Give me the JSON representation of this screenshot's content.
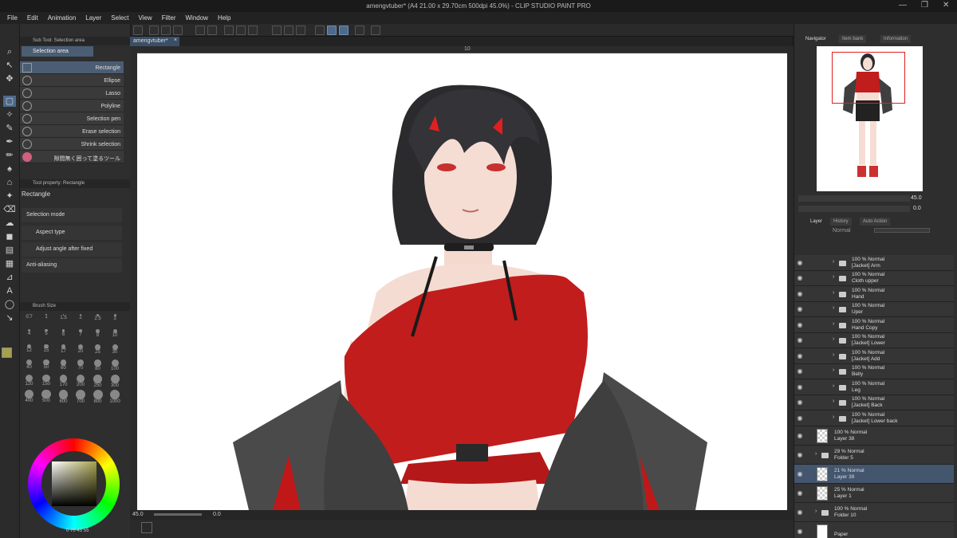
{
  "app": {
    "title": "amengvtuber* (A4 21.00 x 29.70cm 500dpi 45.0%) - CLIP STUDIO PAINT PRO"
  },
  "window_controls": {
    "minimize": "—",
    "restore": "❐",
    "close": "✕"
  },
  "menu": [
    "File",
    "Edit",
    "Animation",
    "Layer",
    "Select",
    "View",
    "Filter",
    "Window",
    "Help"
  ],
  "document_tab": {
    "label": "amengvtuber*",
    "close": "×"
  },
  "ruler": {
    "label": "10"
  },
  "subtool": {
    "panel_title": "Sub Tool: Selection area",
    "group_tab": "Selection area",
    "items": [
      {
        "label": "Rectangle",
        "selected": true
      },
      {
        "label": "Ellipse",
        "selected": false
      },
      {
        "label": "Lasso",
        "selected": false
      },
      {
        "label": "Polyline",
        "selected": false
      },
      {
        "label": "Selection pen",
        "selected": false
      },
      {
        "label": "Erase selection",
        "selected": false
      },
      {
        "label": "Shrink selection",
        "selected": false
      },
      {
        "label": "隙間無く囲って塗るツール",
        "selected": false
      }
    ]
  },
  "tool_property": {
    "panel_title": "Tool property: Rectangle",
    "name": "Rectangle",
    "selection_mode": "Selection mode",
    "aspect_type": "Aspect type",
    "adjust_angle": "Adjust angle after fixed",
    "anti_aliasing": "Anti-aliasing"
  },
  "brush_size": {
    "panel_title": "Brush Size",
    "rows": [
      [
        "0.7",
        "1",
        "1.5",
        "2",
        "2.5",
        "3"
      ],
      [
        "4",
        "5",
        "6",
        "7",
        "8",
        "10"
      ],
      [
        "12",
        "15",
        "17",
        "20",
        "25",
        "30"
      ],
      [
        "40",
        "50",
        "60",
        "70",
        "80",
        "100"
      ],
      [
        "120",
        "150",
        "170",
        "200",
        "250",
        "300"
      ],
      [
        "400",
        "500",
        "600",
        "700",
        "800",
        "1000"
      ]
    ]
  },
  "color": {
    "main": "#a6a24c",
    "sub": "#3a5a9a",
    "readout": [
      "0",
      "70",
      "45",
      "55"
    ]
  },
  "navigator": {
    "tabs": [
      "Navigator",
      "Item bank",
      "Information"
    ],
    "zoom": "45.0",
    "rotate": "0.0"
  },
  "layer_panel": {
    "tabs": [
      "Layer",
      "History",
      "Auto Action"
    ],
    "blend_mode": "Normal",
    "layers": [
      {
        "opacity": "100 % Normal",
        "name": "[Jacket] Arm",
        "type": "folder"
      },
      {
        "opacity": "100 % Normal",
        "name": "Cloth upper",
        "type": "folder"
      },
      {
        "opacity": "100 % Normal",
        "name": "Hand",
        "type": "folder"
      },
      {
        "opacity": "100 % Normal",
        "name": "Uper",
        "type": "folder"
      },
      {
        "opacity": "100 % Normal",
        "name": "Hand Copy",
        "type": "folder"
      },
      {
        "opacity": "100 % Normal",
        "name": "[Jacket] Lower",
        "type": "folder"
      },
      {
        "opacity": "100 % Normal",
        "name": "[Jacket] Add",
        "type": "folder"
      },
      {
        "opacity": "100 % Normal",
        "name": "Belly",
        "type": "folder"
      },
      {
        "opacity": "100 % Normal",
        "name": "Leg",
        "type": "folder"
      },
      {
        "opacity": "100 % Normal",
        "name": "[Jacket] Back",
        "type": "folder"
      },
      {
        "opacity": "100 % Normal",
        "name": "[Jacket] Lower back",
        "type": "folder"
      },
      {
        "opacity": "100 % Normal",
        "name": "Layer 38",
        "type": "raster"
      },
      {
        "opacity": "29 % Normal",
        "name": "Folder 5",
        "type": "folder"
      },
      {
        "opacity": "21 % Normal",
        "name": "Layer 39",
        "type": "raster"
      },
      {
        "opacity": "25 % Normal",
        "name": "Layer 1",
        "type": "vector"
      },
      {
        "opacity": "100 % Normal",
        "name": "Folder 10",
        "type": "folder"
      },
      {
        "opacity": "",
        "name": "Paper",
        "type": "paper"
      }
    ]
  },
  "status": {
    "zoom": "45.0",
    "angle": "0.0"
  }
}
